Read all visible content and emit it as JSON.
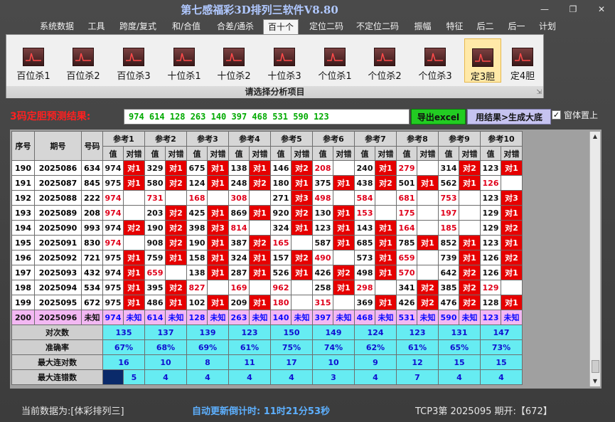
{
  "window": {
    "title": "第七感福彩3D排列三软件V8.80"
  },
  "menu": [
    {
      "label": "系统数据"
    },
    {
      "label": "工具"
    },
    {
      "label": "跨度/复式"
    },
    {
      "label": "和/合值"
    },
    {
      "label": "合差/通杀"
    },
    {
      "label": "百十个",
      "active": true
    },
    {
      "label": "定位二码"
    },
    {
      "label": "不定位二码"
    },
    {
      "label": "振幅"
    },
    {
      "label": "特征"
    },
    {
      "label": "后二"
    },
    {
      "label": "后一"
    },
    {
      "label": "计划"
    }
  ],
  "ribbon": {
    "caption": "请选择分析项目",
    "buttons": [
      {
        "label": "百位杀1"
      },
      {
        "label": "百位杀2"
      },
      {
        "label": "百位杀3"
      },
      {
        "label": "十位杀1"
      },
      {
        "label": "十位杀2"
      },
      {
        "label": "十位杀3"
      },
      {
        "label": "个位杀1"
      },
      {
        "label": "个位杀2"
      },
      {
        "label": "个位杀3"
      },
      {
        "label": "定3胆",
        "selected": true
      },
      {
        "label": "定4胆"
      }
    ]
  },
  "result": {
    "label": "3码定胆预测结果:",
    "value": "974 614 128 263 140 397 468 531 590 123",
    "export_label": "导出excel",
    "generate_label": "用结果>生成大底",
    "ontop_label": "窗体置上",
    "ontop_checked": true
  },
  "grid": {
    "headers": {
      "seq": "序号",
      "period": "期号",
      "code": "号码",
      "value": "值",
      "mark": "对错",
      "refs": [
        "参考1",
        "参考2",
        "参考3",
        "参考4",
        "参考5",
        "参考6",
        "参考7",
        "参考8",
        "参考9",
        "参考10"
      ]
    },
    "rows": [
      {
        "seq": "190",
        "period": "2025086",
        "code": "634",
        "cells": [
          [
            "974",
            "对1"
          ],
          [
            "329",
            "对1"
          ],
          [
            "675",
            "对1"
          ],
          [
            "138",
            "对1"
          ],
          [
            "146",
            "对2"
          ],
          [
            "208",
            ""
          ],
          [
            "240",
            "对1"
          ],
          [
            "279",
            ""
          ],
          [
            "314",
            "对2"
          ],
          [
            "123",
            "对1"
          ]
        ]
      },
      {
        "seq": "191",
        "period": "2025087",
        "code": "845",
        "cells": [
          [
            "975",
            "对1"
          ],
          [
            "580",
            "对2"
          ],
          [
            "124",
            "对1"
          ],
          [
            "248",
            "对2"
          ],
          [
            "180",
            "对1"
          ],
          [
            "375",
            "对1"
          ],
          [
            "438",
            "对2"
          ],
          [
            "501",
            "对1"
          ],
          [
            "562",
            "对1"
          ],
          [
            "126",
            ""
          ]
        ]
      },
      {
        "seq": "192",
        "period": "2025088",
        "code": "222",
        "cells": [
          [
            "974",
            ""
          ],
          [
            "731",
            ""
          ],
          [
            "168",
            ""
          ],
          [
            "308",
            ""
          ],
          [
            "271",
            "对3"
          ],
          [
            "498",
            ""
          ],
          [
            "584",
            ""
          ],
          [
            "681",
            ""
          ],
          [
            "753",
            ""
          ],
          [
            "123",
            "对3"
          ]
        ]
      },
      {
        "seq": "193",
        "period": "2025089",
        "code": "208",
        "cells": [
          [
            "974",
            ""
          ],
          [
            "203",
            "对2"
          ],
          [
            "425",
            "对1"
          ],
          [
            "869",
            "对1"
          ],
          [
            "920",
            "对2"
          ],
          [
            "130",
            "对1"
          ],
          [
            "153",
            ""
          ],
          [
            "175",
            ""
          ],
          [
            "197",
            ""
          ],
          [
            "129",
            "对1"
          ]
        ]
      },
      {
        "seq": "194",
        "period": "2025090",
        "code": "993",
        "cells": [
          [
            "974",
            "对2"
          ],
          [
            "190",
            "对2"
          ],
          [
            "398",
            "对3"
          ],
          [
            "814",
            ""
          ],
          [
            "324",
            "对1"
          ],
          [
            "123",
            "对1"
          ],
          [
            "143",
            "对1"
          ],
          [
            "164",
            ""
          ],
          [
            "185",
            ""
          ],
          [
            "129",
            "对2"
          ]
        ]
      },
      {
        "seq": "195",
        "period": "2025091",
        "code": "830",
        "cells": [
          [
            "974",
            ""
          ],
          [
            "908",
            "对2"
          ],
          [
            "190",
            "对1"
          ],
          [
            "387",
            "对2"
          ],
          [
            "165",
            ""
          ],
          [
            "587",
            "对1"
          ],
          [
            "685",
            "对1"
          ],
          [
            "785",
            "对1"
          ],
          [
            "852",
            "对1"
          ],
          [
            "123",
            "对1"
          ]
        ]
      },
      {
        "seq": "196",
        "period": "2025092",
        "code": "721",
        "cells": [
          [
            "975",
            "对1"
          ],
          [
            "759",
            "对1"
          ],
          [
            "158",
            "对1"
          ],
          [
            "324",
            "对1"
          ],
          [
            "157",
            "对2"
          ],
          [
            "490",
            ""
          ],
          [
            "573",
            "对1"
          ],
          [
            "659",
            ""
          ],
          [
            "739",
            "对1"
          ],
          [
            "126",
            "对2"
          ]
        ]
      },
      {
        "seq": "197",
        "period": "2025093",
        "code": "432",
        "cells": [
          [
            "974",
            "对1"
          ],
          [
            "659",
            ""
          ],
          [
            "138",
            "对1"
          ],
          [
            "287",
            "对1"
          ],
          [
            "526",
            "对1"
          ],
          [
            "426",
            "对2"
          ],
          [
            "498",
            "对1"
          ],
          [
            "570",
            ""
          ],
          [
            "642",
            "对2"
          ],
          [
            "126",
            "对1"
          ]
        ]
      },
      {
        "seq": "198",
        "period": "2025094",
        "code": "534",
        "cells": [
          [
            "975",
            "对1"
          ],
          [
            "395",
            "对2"
          ],
          [
            "827",
            ""
          ],
          [
            "169",
            ""
          ],
          [
            "962",
            ""
          ],
          [
            "258",
            "对1"
          ],
          [
            "298",
            ""
          ],
          [
            "341",
            "对2"
          ],
          [
            "385",
            "对2"
          ],
          [
            "129",
            ""
          ]
        ]
      },
      {
        "seq": "199",
        "period": "2025095",
        "code": "672",
        "cells": [
          [
            "975",
            "对1"
          ],
          [
            "486",
            "对1"
          ],
          [
            "102",
            "对1"
          ],
          [
            "209",
            "对1"
          ],
          [
            "180",
            ""
          ],
          [
            "315",
            ""
          ],
          [
            "369",
            "对1"
          ],
          [
            "426",
            "对2"
          ],
          [
            "476",
            "对2"
          ],
          [
            "128",
            "对1"
          ]
        ]
      }
    ],
    "next": {
      "seq": "200",
      "period": "2025096",
      "code": "未知",
      "values": [
        "974",
        "614",
        "128",
        "263",
        "140",
        "397",
        "468",
        "531",
        "590",
        "123"
      ],
      "mark": "未知"
    },
    "stats": [
      {
        "label": "对次数",
        "values": [
          "135",
          "137",
          "139",
          "123",
          "150",
          "149",
          "124",
          "123",
          "131",
          "147"
        ]
      },
      {
        "label": "准确率",
        "values": [
          "67%",
          "68%",
          "69%",
          "61%",
          "75%",
          "74%",
          "62%",
          "61%",
          "65%",
          "73%"
        ]
      },
      {
        "label": "最大连对数",
        "values": [
          "16",
          "10",
          "8",
          "11",
          "17",
          "10",
          "9",
          "12",
          "15",
          "15"
        ]
      },
      {
        "label": "最大连错数",
        "values": [
          "5",
          "4",
          "4",
          "4",
          "4",
          "3",
          "4",
          "7",
          "4",
          "4"
        ]
      }
    ]
  },
  "status": {
    "data_label": "当前数据为:[体彩排列三]",
    "countdown": "自动更新倒计时: 11时21分53秒",
    "draw": "TCP3第 2025095 期开:【672】"
  }
}
